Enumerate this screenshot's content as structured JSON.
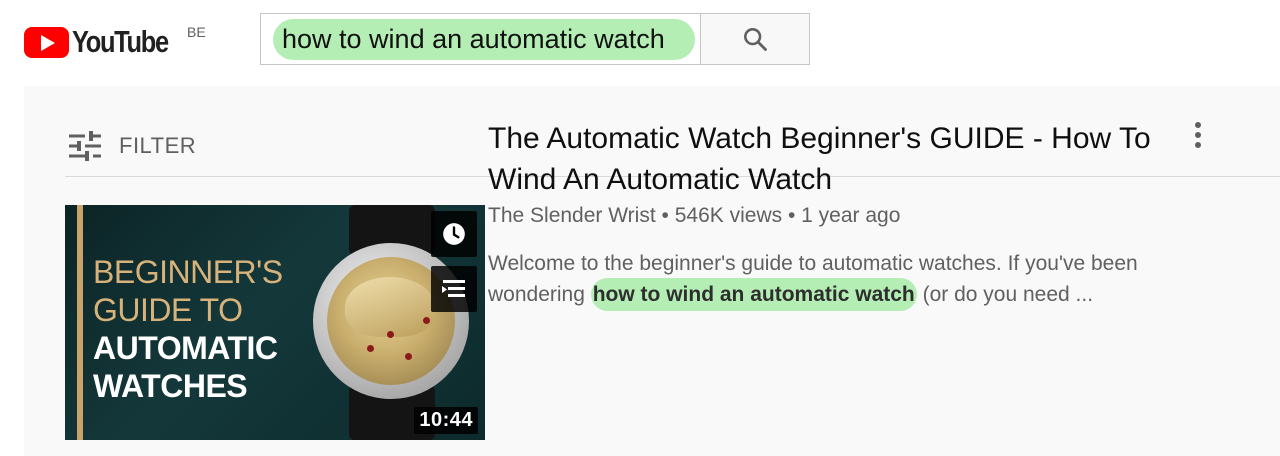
{
  "header": {
    "logo_text": "YouTube",
    "region": "BE",
    "search_value": "how to wind an automatic watch",
    "search_button_icon": "search-icon",
    "highlight_color": "#b4eeb4"
  },
  "filter": {
    "label": "FILTER",
    "icon": "filter-sliders-icon"
  },
  "result": {
    "thumbnail": {
      "line1": "BEGINNER'S",
      "line2": "GUIDE TO",
      "line3": "AUTOMATIC",
      "line4": "WATCHES",
      "duration": "10:44",
      "watch_later_icon": "clock-icon",
      "add_to_queue_icon": "queue-icon"
    },
    "title": "The Automatic Watch Beginner's GUIDE - How To Wind An Automatic Watch",
    "channel": "The Slender Wrist",
    "views": "546K views",
    "age": "1 year ago",
    "separator": "•",
    "description_before": "Welcome to the beginner's guide to automatic watches. If you've been wondering ",
    "description_highlight": "how to wind an automatic watch",
    "description_after": " (or do you need ...",
    "more_icon": "more-vertical-icon"
  }
}
